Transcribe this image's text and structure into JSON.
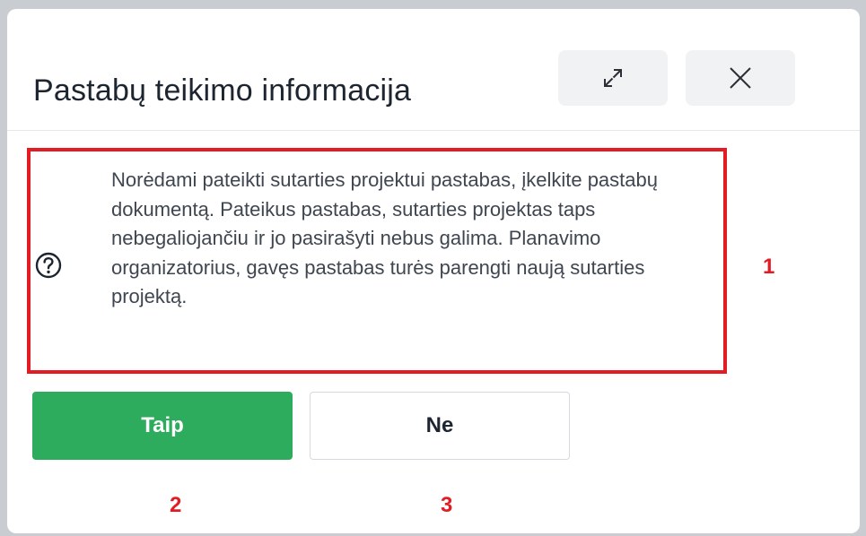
{
  "dialog": {
    "title": "Pastabų teikimo informacija",
    "expand_icon": "expand-icon",
    "close_icon": "close-icon"
  },
  "info": {
    "icon": "question-circle-icon",
    "text": "Norėdami pateikti sutarties projektui pastabas, įkelkite pastabų dokumentą. Pateikus pastabas, sutarties projektas taps nebegaliojančiu ir jo pasirašyti nebus galima. Planavimo organizatorius, gavęs pastabas turės parengti naują sutarties projektą."
  },
  "buttons": {
    "yes_label": "Taip",
    "no_label": "Ne"
  },
  "annotations": {
    "marker_1": "1",
    "marker_2": "2",
    "marker_3": "3"
  },
  "colors": {
    "primary_green": "#2eac5e",
    "highlight_red": "#e31b23",
    "title_text": "#1d2530",
    "body_text": "#3f4650"
  }
}
